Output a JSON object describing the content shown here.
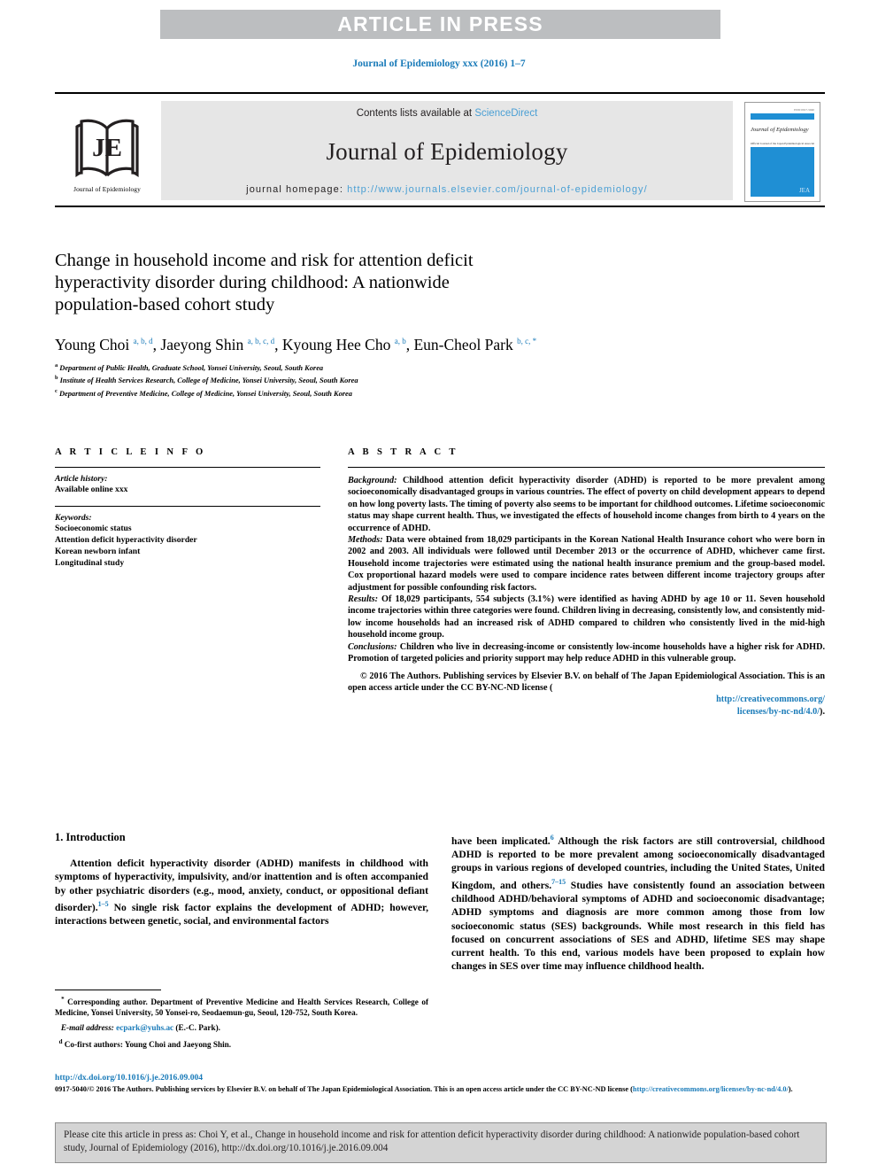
{
  "banner": {
    "text": "ARTICLE IN PRESS"
  },
  "citation_line": "Journal of Epidemiology xxx (2016) 1–7",
  "masthead": {
    "logo_caption": "Journal of Epidemiology",
    "logo_letters": "JE",
    "contents_prefix": "Contents lists available at ",
    "contents_link": "ScienceDirect",
    "journal_title": "Journal of Epidemiology",
    "homepage_prefix": "journal homepage: ",
    "homepage_url": "http://www.journals.elsevier.com/journal-of-epidemiology/",
    "cover": {
      "top_number": "ISSN 0917-5040",
      "title": "Journal of Epidemiology",
      "association": "Official Journal of the Japan Epidemiological Association",
      "mark": "JEA"
    }
  },
  "article": {
    "title_line1": "Change in household income and risk for attention deficit",
    "title_line2": "hyperactivity disorder during childhood: A nationwide",
    "title_line3": "population-based cohort study",
    "authors": [
      {
        "name": "Young Choi",
        "sup": "a, b, d"
      },
      {
        "name": "Jaeyong Shin",
        "sup": "a, b, c, d"
      },
      {
        "name": "Kyoung Hee Cho",
        "sup": "a, b"
      },
      {
        "name": "Eun-Cheol Park",
        "sup": "b, c, *"
      }
    ],
    "affiliations": [
      {
        "mark": "a",
        "text": "Department of Public Health, Graduate School, Yonsei University, Seoul, South Korea"
      },
      {
        "mark": "b",
        "text": "Institute of Health Services Research, College of Medicine, Yonsei University, Seoul, South Korea"
      },
      {
        "mark": "c",
        "text": "Department of Preventive Medicine, College of Medicine, Yonsei University, Seoul, South Korea"
      }
    ]
  },
  "info": {
    "heading": "A R T I C L E   I N F O",
    "history_label": "Article history:",
    "history_value": "Available online xxx",
    "keywords_label": "Keywords:",
    "keywords": [
      "Socioeconomic status",
      "Attention deficit hyperactivity disorder",
      "Korean newborn infant",
      "Longitudinal study"
    ]
  },
  "abstract": {
    "heading": "A B S T R A C T",
    "background_label": "Background:",
    "background_text": " Childhood attention deficit hyperactivity disorder (ADHD) is reported to be more prevalent among socioeconomically disadvantaged groups in various countries. The effect of poverty on child development appears to depend on how long poverty lasts. The timing of poverty also seems to be important for childhood outcomes. Lifetime socioeconomic status may shape current health. Thus, we investigated the effects of household income changes from birth to 4 years on the occurrence of ADHD.",
    "methods_label": "Methods:",
    "methods_text": " Data were obtained from 18,029 participants in the Korean National Health Insurance cohort who were born in 2002 and 2003. All individuals were followed until December 2013 or the occurrence of ADHD, whichever came first. Household income trajectories were estimated using the national health insurance premium and the group-based model. Cox proportional hazard models were used to compare incidence rates between different income trajectory groups after adjustment for possible confounding risk factors.",
    "results_label": "Results:",
    "results_text": " Of 18,029 participants, 554 subjects (3.1%) were identified as having ADHD by age 10 or 11. Seven household income trajectories within three categories were found. Children living in decreasing, consistently low, and consistently mid-low income households had an increased risk of ADHD compared to children who consistently lived in the mid-high household income group.",
    "conclusions_label": "Conclusions:",
    "conclusions_text": " Children who live in decreasing-income or consistently low-income households have a higher risk for ADHD. Promotion of targeted policies and priority support may help reduce ADHD in this vulnerable group.",
    "copyright_text": "© 2016 The Authors. Publishing services by Elsevier B.V. on behalf of The Japan Epidemiological Association. This is an open access article under the CC BY-NC-ND license (",
    "copyright_link_1": "http://creativecommons.org/",
    "copyright_link_2": "licenses/by-nc-nd/4.0/",
    "copyright_tail": ")."
  },
  "body": {
    "intro_heading": "1. Introduction",
    "left_p1_a": "Attention deficit hyperactivity disorder (ADHD) manifests in childhood with symptoms of hyperactivity, impulsivity, and/or inattention and is often accompanied by other psychiatric disorders (e.g., mood, anxiety, conduct, or oppositional defiant disorder).",
    "left_p1_sup": "1–5",
    "left_p1_b": " No single risk factor explains the development of ADHD; however, interactions between genetic, social, and environmental factors",
    "right_p1_a": "have been implicated.",
    "right_p1_sup1": "6",
    "right_p1_b": " Although the risk factors are still controversial, childhood ADHD is reported to be more prevalent among socioeconomically disadvantaged groups in various regions of developed countries, including the United States, United Kingdom, and others.",
    "right_p1_sup2": "7–15",
    "right_p1_c": " Studies have consistently found an association between childhood ADHD/behavioral symptoms of ADHD and socioeconomic disadvantage; ADHD symptoms and diagnosis are more common among those from low socioeconomic status (SES) backgrounds. While most research in this field has focused on concurrent associations of SES and ADHD, lifetime SES may shape current health. To this end, various models have been proposed to explain how changes in SES over time may influence childhood health."
  },
  "footnotes": {
    "corresponding_mark": "*",
    "corresponding_text": " Corresponding author. Department of Preventive Medicine and Health Services Research, College of Medicine, Yonsei University, 50 Yonsei-ro, Seodaemun-gu, Seoul, 120-752, South Korea.",
    "email_label": "E-mail address:",
    "email_value": "ecpark@yuhs.ac",
    "email_suffix": " (E.-C. Park).",
    "cofirst_mark": "d",
    "cofirst_text": " Co-first authors: Young Choi and Jaeyong Shin."
  },
  "publisher": {
    "doi": "http://dx.doi.org/10.1016/j.je.2016.09.004",
    "issn_copyright": "0917-5040/© 2016 The Authors. Publishing services by Elsevier B.V. on behalf of The Japan Epidemiological Association. This is an open access article under the CC BY-NC-ND license (",
    "license_url": "http://creativecommons.org/licenses/by-nc-nd/4.0/",
    "license_tail": ")."
  },
  "cite_box": {
    "text": "Please cite this article in press as: Choi Y, et al., Change in household income and risk for attention deficit hyperactivity disorder during childhood: A nationwide population-based cohort study, Journal of Epidemiology (2016), http://dx.doi.org/10.1016/j.je.2016.09.004"
  },
  "colors": {
    "banner_gray": "#bcbec0",
    "link_blue": "#1a7bb9",
    "light_blue": "#4a9fd4",
    "masthead_gray": "#e6e6e6",
    "cite_box_gray": "#d4d4d4",
    "cover_blue": "#1f8fd4"
  }
}
